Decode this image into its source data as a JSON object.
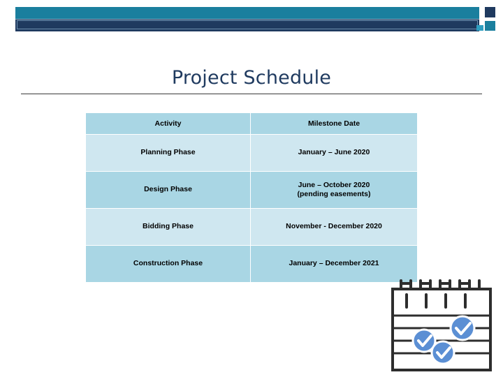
{
  "slide": {
    "title": "Project Schedule"
  },
  "table": {
    "headers": [
      "Activity",
      "Milestone Date"
    ],
    "rows": [
      {
        "activity": "Planning Phase",
        "milestone": "January – June 2020"
      },
      {
        "activity": "Design Phase",
        "milestone": "June – October 2020\n(pending easements)"
      },
      {
        "activity": "Bidding Phase",
        "milestone": "November - December 2020"
      },
      {
        "activity": "Construction Phase",
        "milestone": "January – December 2021"
      }
    ]
  },
  "graphics": {
    "calendar_icon_name": "calendar-checkmarks-icon",
    "banner_name": "decorative-top-banner"
  },
  "colors": {
    "banner_teal": "#1a7f9e",
    "banner_navy": "#1f3a5f",
    "header_fill": "#a9d6e4",
    "row_light": "#cfe7f0",
    "title_color": "#1f3a5f",
    "check_blue": "#5b8fd4"
  }
}
